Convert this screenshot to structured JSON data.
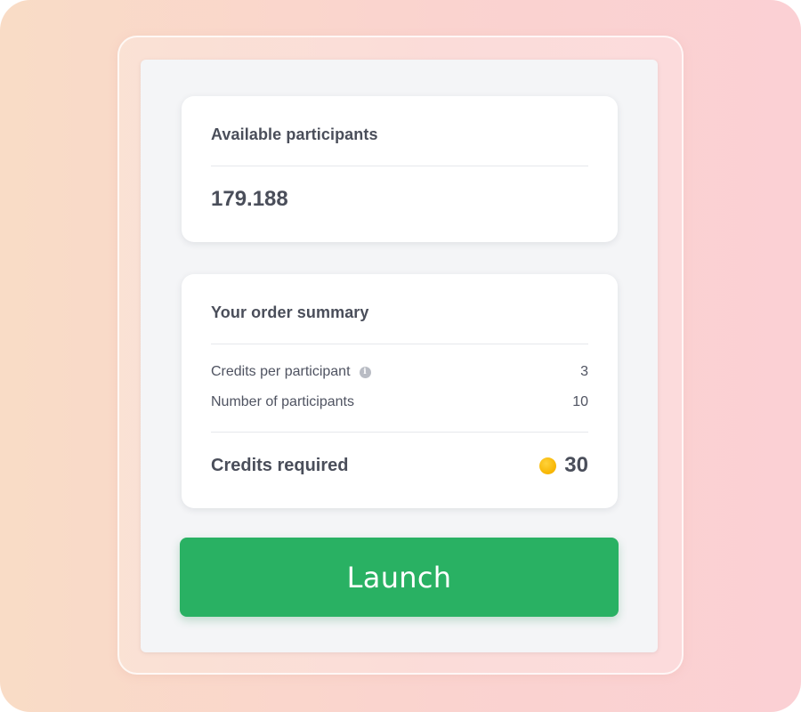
{
  "participants_card": {
    "title": "Available participants",
    "value": "179.188"
  },
  "summary_card": {
    "title": "Your order summary",
    "rows": [
      {
        "label": "Credits per participant",
        "value": "3",
        "has_info_icon": true
      },
      {
        "label": "Number of participants",
        "value": "10",
        "has_info_icon": false
      }
    ],
    "total_label": "Credits required",
    "total_value": "30",
    "info_icon_glyph": "i"
  },
  "launch_button": {
    "label": "Launch"
  },
  "colors": {
    "accent_green": "#29b163",
    "coin_yellow": "#f7b500",
    "text_dark": "#4a4e5a"
  },
  "icons": {
    "info": "info-icon",
    "credits": "coin-icon"
  }
}
